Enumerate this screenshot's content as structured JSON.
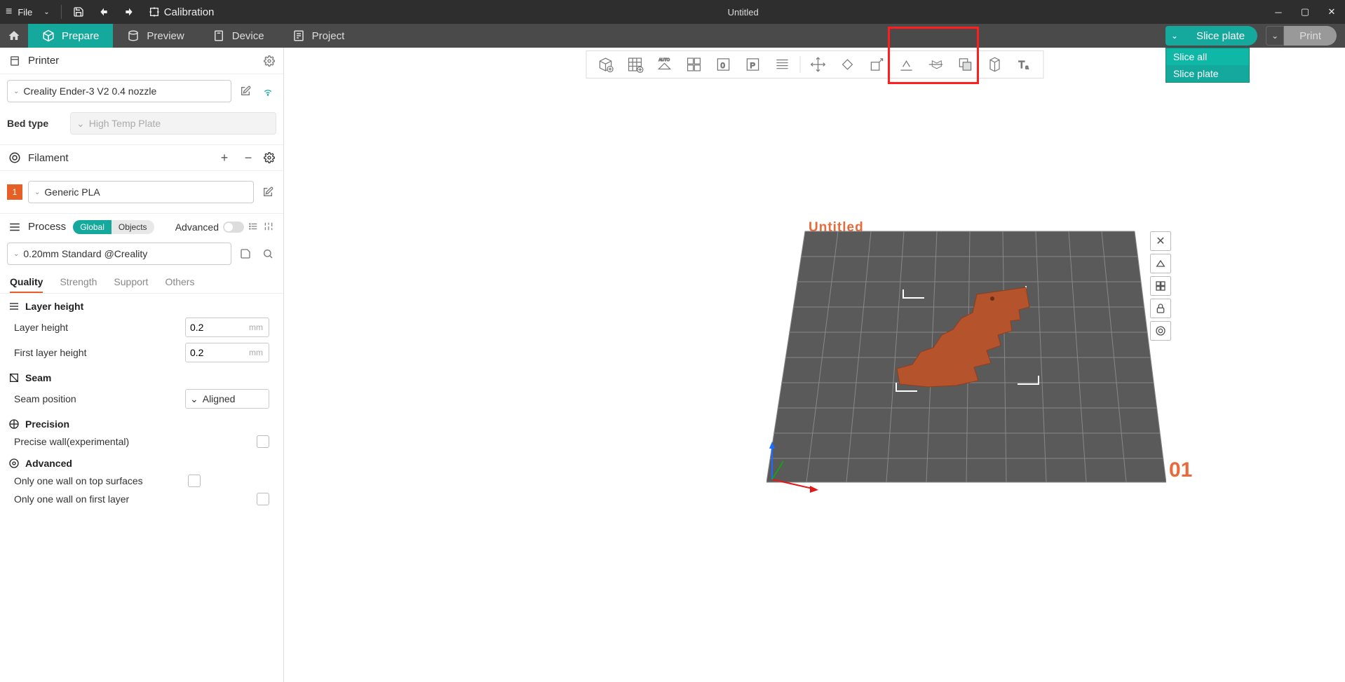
{
  "titlebar": {
    "file_label": "File",
    "calibration": "Calibration",
    "title": "Untitled"
  },
  "nav": {
    "prepare": "Prepare",
    "preview": "Preview",
    "device": "Device",
    "project": "Project",
    "slice_plate": "Slice plate",
    "print": "Print"
  },
  "slice_menu": {
    "slice_all": "Slice all",
    "slice_plate": "Slice plate"
  },
  "sidebar": {
    "printer_label": "Printer",
    "printer_selected": "Creality Ender-3 V2 0.4 nozzle",
    "bed_type_label": "Bed type",
    "bed_type_value": "High Temp Plate",
    "filament_label": "Filament",
    "filament_index": "1",
    "filament_selected": "Generic PLA",
    "process_label": "Process",
    "global": "Global",
    "objects": "Objects",
    "advanced": "Advanced",
    "preset": "0.20mm Standard @Creality",
    "tabs": {
      "quality": "Quality",
      "strength": "Strength",
      "support": "Support",
      "others": "Others"
    },
    "layer_height_group": "Layer height",
    "layer_height": "Layer height",
    "layer_height_val": "0.2",
    "first_layer_height": "First layer height",
    "first_layer_height_val": "0.2",
    "unit_mm": "mm",
    "seam_group": "Seam",
    "seam_position": "Seam position",
    "seam_position_val": "Aligned",
    "precision_group": "Precision",
    "precise_wall": "Precise wall(experimental)",
    "advanced_group": "Advanced",
    "only_one_wall_top": "Only one wall on top surfaces",
    "only_one_wall_first": "Only one wall on first layer"
  },
  "viewport": {
    "plate_name": "Untitled",
    "plate_number": "01"
  }
}
